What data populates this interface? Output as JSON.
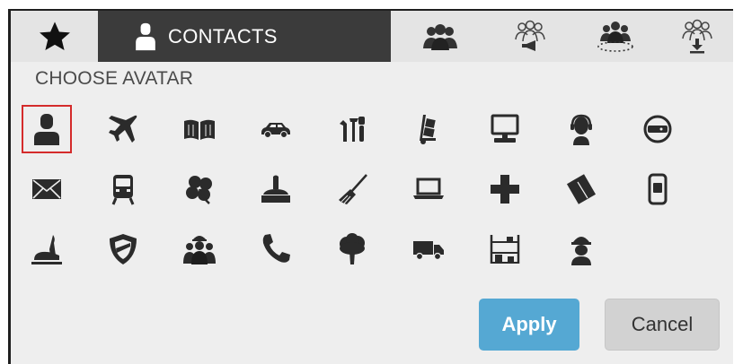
{
  "tabs": {
    "favorites_icon": "star-icon",
    "contacts_label": "CONTACTS",
    "contacts_icon": "person-icon",
    "group_icons": [
      "people-group-icon",
      "group-broadcast-icon",
      "group-meeting-icon",
      "group-download-icon"
    ]
  },
  "chooser": {
    "title": "CHOOSE AVATAR",
    "selected_avatar": "person-icon",
    "avatars": [
      "person-icon",
      "airplane-icon",
      "open-book-icon",
      "car-icon",
      "tools-icon",
      "hand-truck-icon",
      "desktop-computer-icon",
      "headset-agent-icon",
      "disc-drive-icon",
      "envelope-icon",
      "train-icon",
      "clover-icon",
      "desk-bell-icon",
      "broom-icon",
      "laptop-icon",
      "plus-cross-icon",
      "notebook-icon",
      "mobile-phone-icon",
      "landing-plane-icon",
      "shield-icon",
      "workers-group-icon",
      "phone-handset-icon",
      "tree-icon",
      "truck-icon",
      "warehouse-shelf-icon",
      "construction-worker-icon"
    ]
  },
  "actions": {
    "apply_label": "Apply",
    "cancel_label": "Cancel"
  },
  "colors": {
    "active_tab": "#3b3b3b",
    "apply_button": "#55a8d3",
    "selection_border": "#d42b2b",
    "icon": "#2b2b2b"
  }
}
